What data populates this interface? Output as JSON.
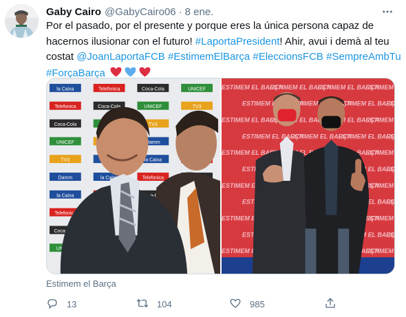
{
  "tweet": {
    "author_name": "Gaby Cairo",
    "author_handle": "@GabyCairo06",
    "separator": "·",
    "date": "8 ene.",
    "text_line1_a": "Por el pasado, por el presente y porque eres la única persona capaz  de",
    "text_line2_a": "hacernos ilusionar con el futuro! ",
    "hashtag_laporta": "#LaportaPresident",
    "text_line2_b": "! Ahir, avui i demà al teu",
    "text_line3_a": "costat ",
    "mention_joan": "@JoanLaportaFCB",
    "hashtag_estimem": "#EstimemElBarça",
    "hashtag_elecciones": "#EleccionsFCB",
    "hashtag_sempre": "#SempreAmbTu",
    "hashtag_forca": "#ForçaBarça",
    "hearts": [
      {
        "icon": "red-heart-icon",
        "color": "#dd2e44"
      },
      {
        "icon": "blue-heart-icon",
        "color": "#5dadec"
      },
      {
        "icon": "red-heart-icon",
        "color": "#dd2e44"
      }
    ],
    "card_source": "Estimem el Barça",
    "replies": "13",
    "retweets": "104",
    "likes": "985",
    "link_color": "#1b95e0"
  },
  "photo_left": {
    "sponsor_boards": [
      "la Caixa",
      "Telefonica",
      "Coca-Cola",
      "UNICEF",
      "TV3",
      "Damm"
    ]
  },
  "photo_right": {
    "backdrop_text": "ESTIMEM EL BARÇA"
  }
}
